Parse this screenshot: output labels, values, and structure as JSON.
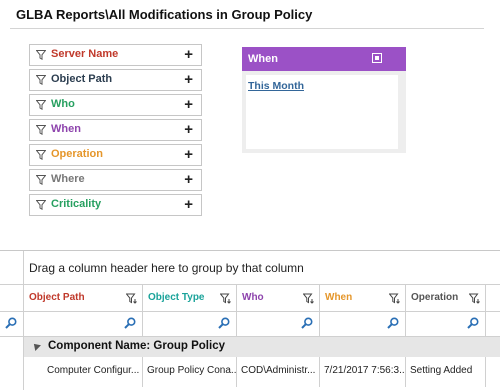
{
  "page": {
    "title": "GLBA Reports\\All Modifications in  Group Policy"
  },
  "filters": [
    {
      "label": "Server Name",
      "color": "#c0392b"
    },
    {
      "label": "Object Path",
      "color": "#2c3e50"
    },
    {
      "label": "Who",
      "color": "#27a060"
    },
    {
      "label": "When",
      "color": "#8e44ad"
    },
    {
      "label": "Operation",
      "color": "#e5962a"
    },
    {
      "label": "Where",
      "color": "#777777"
    },
    {
      "label": "Criticality",
      "color": "#27a060"
    }
  ],
  "when_panel": {
    "title": "When",
    "link": "This Month",
    "header_color": "#9b51c6"
  },
  "grid": {
    "group_panel_text": "Drag a column header here to group by that column",
    "columns": [
      {
        "label": "Object Path",
        "color": "#c0392b"
      },
      {
        "label": "Object Type",
        "color": "#1aa39a"
      },
      {
        "label": "Who",
        "color": "#8e44ad"
      },
      {
        "label": "When",
        "color": "#e5962a"
      },
      {
        "label": "Operation",
        "color": "#555555"
      }
    ],
    "group_row": "Component Name: Group Policy",
    "rows": [
      [
        "Computer Configur...",
        "Group Policy Cona...",
        "COD\\Administr...",
        "7/21/2017 7:56:3...",
        "Setting Added"
      ]
    ]
  }
}
